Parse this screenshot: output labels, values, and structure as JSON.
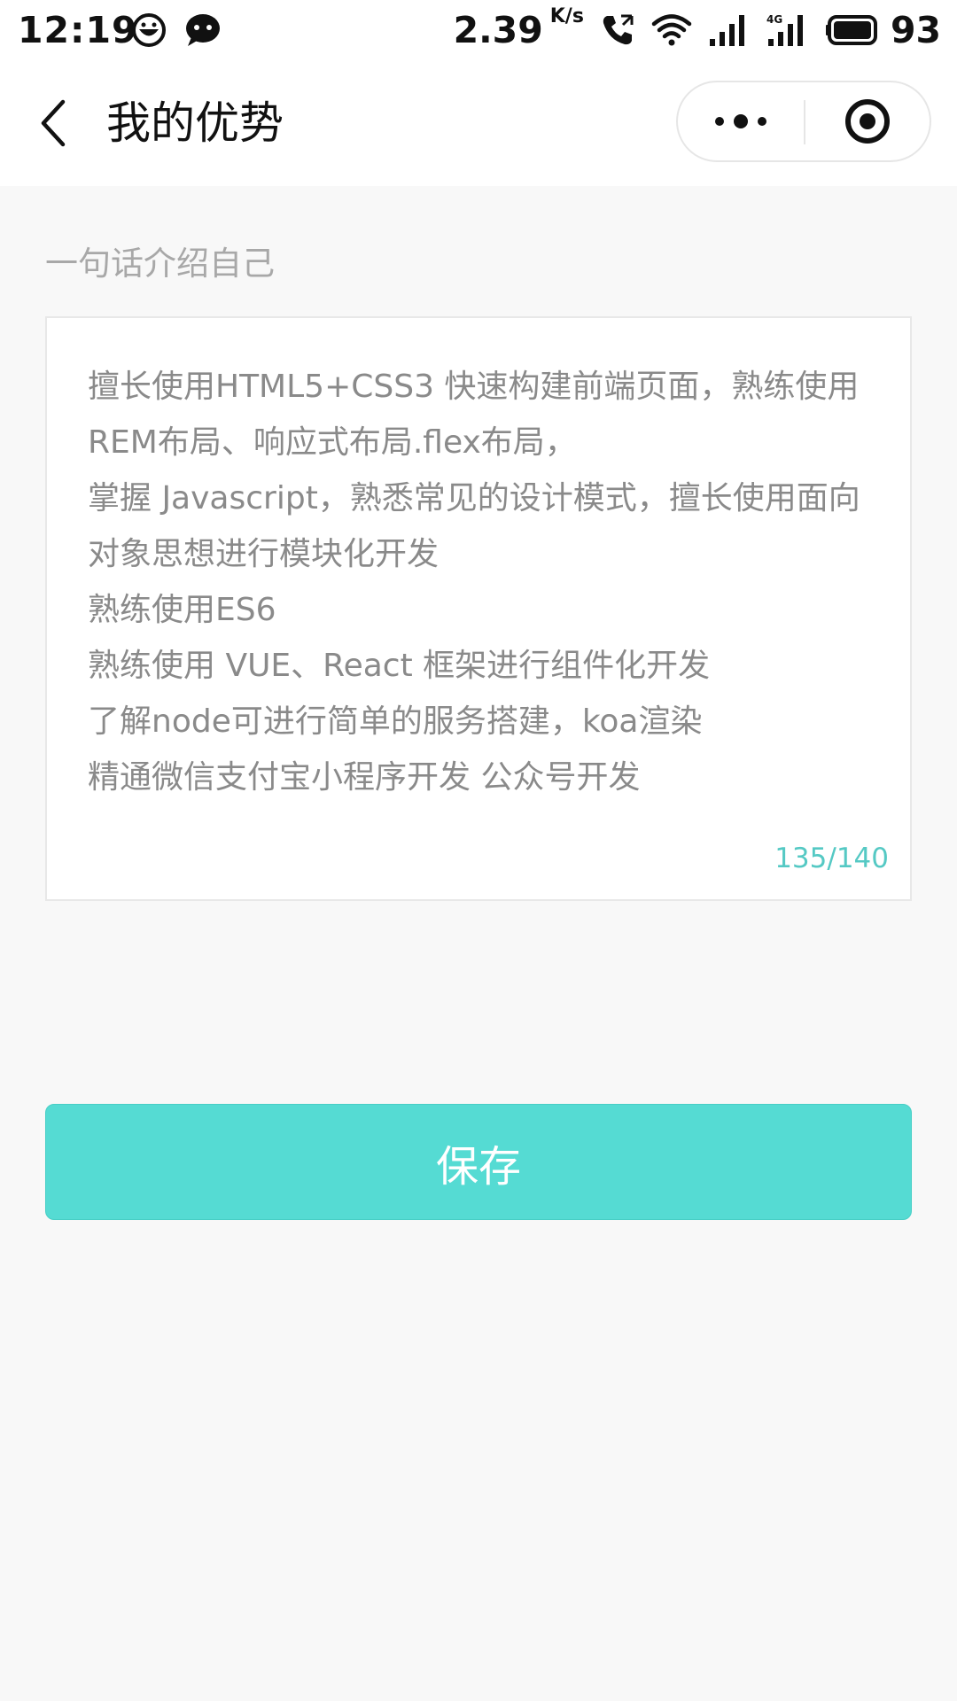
{
  "status_bar": {
    "time": "12:19",
    "net_speed": "2.39",
    "net_speed_unit": "K/s",
    "battery": "93",
    "icons": [
      "face-app-icon",
      "chat-app-icon",
      "phone-call-icon",
      "wifi-icon",
      "signal-icon",
      "signal-4g-icon",
      "battery-icon"
    ]
  },
  "nav": {
    "title": "我的优势",
    "icons": [
      "back-chevron-icon",
      "more-dots-icon",
      "close-target-icon"
    ]
  },
  "form": {
    "label": "一句话介绍自己",
    "intro": "擅长使用HTML5+CSS3 快速构建前端页面，熟练使用REM布局、响应式布局.flex布局，\n掌握 Javascript，熟悉常见的设计模式，擅长使用面向对象思想进行模块化开发\n熟练使用ES6\n熟练使用 VUE、React 框架进行组件化开发\n了解node可进行简单的服务搭建，koa渲染\n精通微信支付宝小程序开发 公众号开发",
    "char_count": "135/140",
    "save_label": "保存"
  },
  "colors": {
    "accent": "#55dbd3",
    "counter": "#55c9c4",
    "background": "#f8f8f8"
  }
}
